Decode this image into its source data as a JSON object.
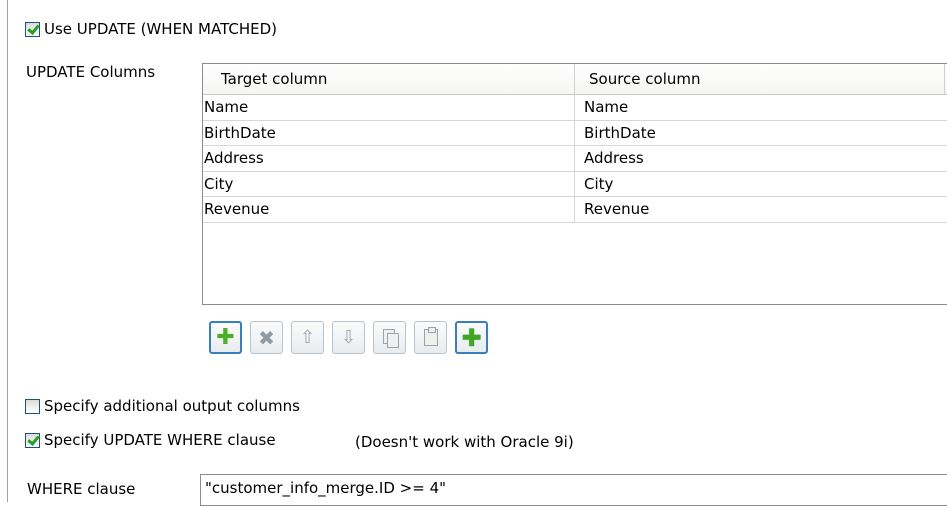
{
  "use_update": {
    "label": "Use UPDATE (WHEN MATCHED)",
    "checked": true
  },
  "update_columns": {
    "label": "UPDATE Columns",
    "headers": [
      "Target column",
      "Source column"
    ],
    "rows": [
      [
        "Name",
        "Name"
      ],
      [
        "BirthDate",
        "BirthDate"
      ],
      [
        "Address",
        "Address"
      ],
      [
        "City",
        "City"
      ],
      [
        "Revenue",
        "Revenue"
      ]
    ]
  },
  "toolbar": {
    "buttons": [
      {
        "icon": "add-icon",
        "enabled": true
      },
      {
        "icon": "remove-icon",
        "enabled": false
      },
      {
        "icon": "move-up-icon",
        "enabled": false
      },
      {
        "icon": "move-down-icon",
        "enabled": false
      },
      {
        "icon": "copy-icon",
        "enabled": false
      },
      {
        "icon": "paste-icon",
        "enabled": false
      },
      {
        "icon": "add-all-icon",
        "enabled": true
      }
    ]
  },
  "additional_output": {
    "label": "Specify additional output columns",
    "checked": false
  },
  "update_where": {
    "label": "Specify UPDATE WHERE clause",
    "checked": true,
    "note": "(Doesn't work with Oracle 9i)"
  },
  "where_clause": {
    "label": "WHERE clause",
    "value": "\"customer_info_merge.ID >= 4\""
  }
}
